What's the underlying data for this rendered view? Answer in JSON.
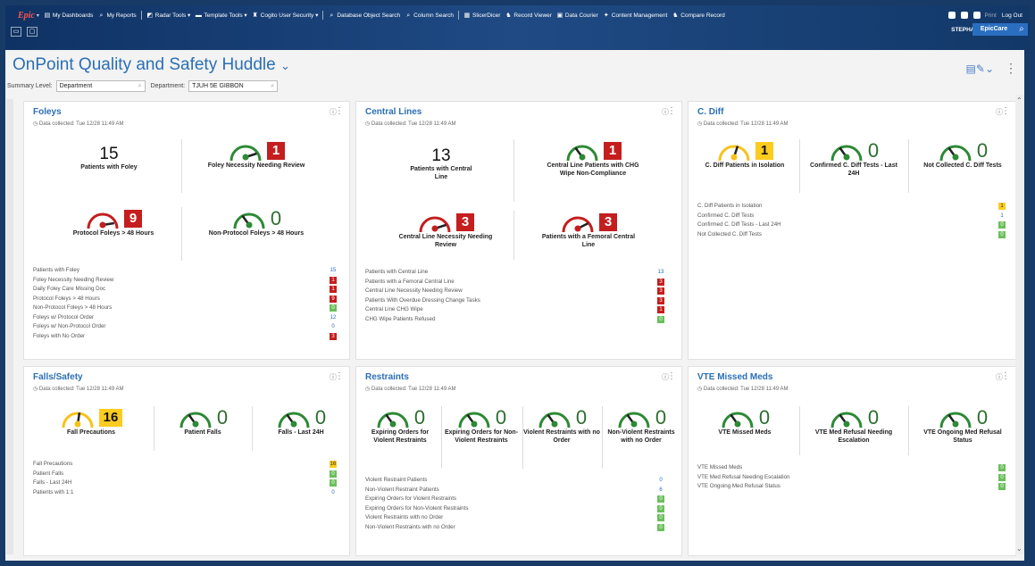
{
  "menu": {
    "logo": "Epic",
    "items": [
      {
        "icon": "dashboard-icon",
        "label": "My Dashboards"
      },
      {
        "icon": "search-icon",
        "label": "My Reports"
      },
      {
        "icon": "radar-icon",
        "label": "Radar Tools"
      },
      {
        "icon": "folder-icon",
        "label": "Template Tools"
      },
      {
        "icon": "security-icon",
        "label": "Cogito User Security"
      },
      {
        "icon": "search-icon",
        "label": "Database Object Search"
      },
      {
        "icon": "search-icon",
        "label": "Column Search"
      },
      {
        "icon": "slicer-icon",
        "label": "SlicerDicer"
      },
      {
        "icon": "binoculars-icon",
        "label": "Record Viewer"
      },
      {
        "icon": "courier-icon",
        "label": "Data Courier"
      },
      {
        "icon": "content-icon",
        "label": "Content Management"
      },
      {
        "icon": "binoculars-icon",
        "label": "Compare Record"
      }
    ],
    "right": {
      "print": "Print",
      "logout": "Log Out"
    },
    "user": "STEPHANIE O.",
    "app": "EpicCare"
  },
  "header": {
    "title": "OnPoint Quality and Safety Huddle",
    "summary_label": "Summary Level:",
    "summary_value": "Department",
    "dept_label": "Department:",
    "dept_value": "TJUH 5E GIBBON"
  },
  "collected": "Data collected: Tue 12/28 11:49 AM",
  "cards": {
    "foleys": {
      "title": "Foleys",
      "t1": {
        "num": "15",
        "label": "Patients with Foley"
      },
      "t2": {
        "num": "1",
        "label": "Foley Necessity Needing Review",
        "level": 0.9
      },
      "t3": {
        "num": "9",
        "label": "Protocol Foleys > 48 Hours",
        "level": 0.95
      },
      "t4": {
        "num": "0",
        "label": "Non-Protocol Foleys > 48 Hours",
        "level": 0.3
      },
      "rows": [
        {
          "label": "Patients with Foley",
          "value": "15",
          "style": "plain"
        },
        {
          "label": "Foley Necessity Needing Review",
          "value": "1",
          "style": "red"
        },
        {
          "label": "Daily Foley Care Missing Doc",
          "value": "1",
          "style": "red"
        },
        {
          "label": "Protocol Foleys > 48 Hours",
          "value": "9",
          "style": "red"
        },
        {
          "label": "Non-Protocol Foleys > 48 Hours",
          "value": "0",
          "style": "grn"
        },
        {
          "label": "Foleys w/ Protocol Order",
          "value": "12",
          "style": "plain"
        },
        {
          "label": "Foleys w/ Non-Protocol Order",
          "value": "0",
          "style": "plain"
        },
        {
          "label": "Foleys with No Order",
          "value": "3",
          "style": "red"
        }
      ]
    },
    "central": {
      "title": "Central Lines",
      "t1": {
        "num": "13",
        "label": "Patients with Central Line"
      },
      "t2": {
        "num": "1",
        "label": "Central Line Patients with CHG Wipe Non-Compliance",
        "level": 0.3
      },
      "t3": {
        "num": "3",
        "label": "Central Line Necessity Needing Review",
        "level": 0.9
      },
      "t4": {
        "num": "3",
        "label": "Patients with a Femoral Central Line",
        "level": 0.85
      },
      "rows": [
        {
          "label": "Patients with Central Line",
          "value": "13",
          "style": "plain"
        },
        {
          "label": "Patients with a Femoral Central Line",
          "value": "3",
          "style": "red"
        },
        {
          "label": "Central Line Necessity Needing Review",
          "value": "3",
          "style": "red"
        },
        {
          "label": "Patients With Overdue Dressing Change Tasks",
          "value": "3",
          "style": "red"
        },
        {
          "label": "Central Line CHG Wipe",
          "value": "1",
          "style": "red"
        },
        {
          "label": "CHG Wipe Patients Refused",
          "value": "0",
          "style": "grn"
        }
      ]
    },
    "cdiff": {
      "title": "C. Diff",
      "t1": {
        "num": "1",
        "label": "C. Diff Patients in Isolation",
        "level": 0.6
      },
      "t2": {
        "num": "0",
        "label": "Confirmed C. Diff Tests - Last 24H",
        "level": 0.3
      },
      "t3": {
        "num": "0",
        "label": "Not Collected C. Diff Tests",
        "level": 0.3
      },
      "rows": [
        {
          "label": "C. Diff Patients in Isolation",
          "value": "1",
          "style": "yel"
        },
        {
          "label": "Confirmed C. Diff Tests",
          "value": "1",
          "style": "plain"
        },
        {
          "label": "Confirmed C. Diff Tests - Last 24H",
          "value": "0",
          "style": "grn"
        },
        {
          "label": "Not Collected C. Diff Tests",
          "value": "0",
          "style": "grn"
        }
      ]
    },
    "falls": {
      "title": "Falls/Safety",
      "t1": {
        "num": "16",
        "label": "Fall Precautions",
        "level": 0.55
      },
      "t2": {
        "num": "0",
        "label": "Patient Falls",
        "level": 0.3
      },
      "t3": {
        "num": "0",
        "label": "Falls - Last 24H",
        "level": 0.3
      },
      "rows": [
        {
          "label": "Fall Precautions",
          "value": "16",
          "style": "yel"
        },
        {
          "label": "Patient Falls",
          "value": "0",
          "style": "grn"
        },
        {
          "label": "Falls - Last 24H",
          "value": "0",
          "style": "grn"
        },
        {
          "label": "Patients with 1:1",
          "value": "0",
          "style": "plain"
        }
      ]
    },
    "restraints": {
      "title": "Restraints",
      "t1": {
        "num": "0",
        "label": "Expiring Orders for Violent Restraints",
        "level": 0.3
      },
      "t2": {
        "num": "0",
        "label": "Expiring Orders for Non-Violent Restraints",
        "level": 0.3
      },
      "t3": {
        "num": "0",
        "label": "Violent Restraints with no Order",
        "level": 0.3
      },
      "t4": {
        "num": "0",
        "label": "Non-Violent Restraints with no Order",
        "level": 0.3
      },
      "rows": [
        {
          "label": "Violent Restraint Patients",
          "value": "0",
          "style": "plain"
        },
        {
          "label": "Non-Violent Restraint Patients",
          "value": "6",
          "style": "plain"
        },
        {
          "label": "Expiring Orders for Violent Restraints",
          "value": "0",
          "style": "grn"
        },
        {
          "label": "Expiring Orders for Non-Violent Restraints",
          "value": "0",
          "style": "grn"
        },
        {
          "label": "Violent Restraints with no Order",
          "value": "0",
          "style": "grn"
        },
        {
          "label": "Non-Violent Restraints with no Order",
          "value": "0",
          "style": "grn"
        }
      ]
    },
    "vte": {
      "title": "VTE Missed Meds",
      "t1": {
        "num": "0",
        "label": "VTE Missed Meds",
        "level": 0.3
      },
      "t2": {
        "num": "0",
        "label": "VTE Med Refusal Needing Escalation",
        "level": 0.3
      },
      "t3": {
        "num": "0",
        "label": "VTE Ongoing Med Refusal Status",
        "level": 0.3
      },
      "rows": [
        {
          "label": "VTE Missed Meds",
          "value": "0",
          "style": "grn"
        },
        {
          "label": "VTE Med Refusal Needing Escalation",
          "value": "0",
          "style": "grn"
        },
        {
          "label": "VTE Ongoing Med Refusal Status",
          "value": "0",
          "style": "grn"
        }
      ]
    }
  },
  "colors": {
    "red": "#c41e1e",
    "green": "#2d8a36",
    "yellow": "#f7c21a",
    "accent": "#2a6fb5"
  }
}
